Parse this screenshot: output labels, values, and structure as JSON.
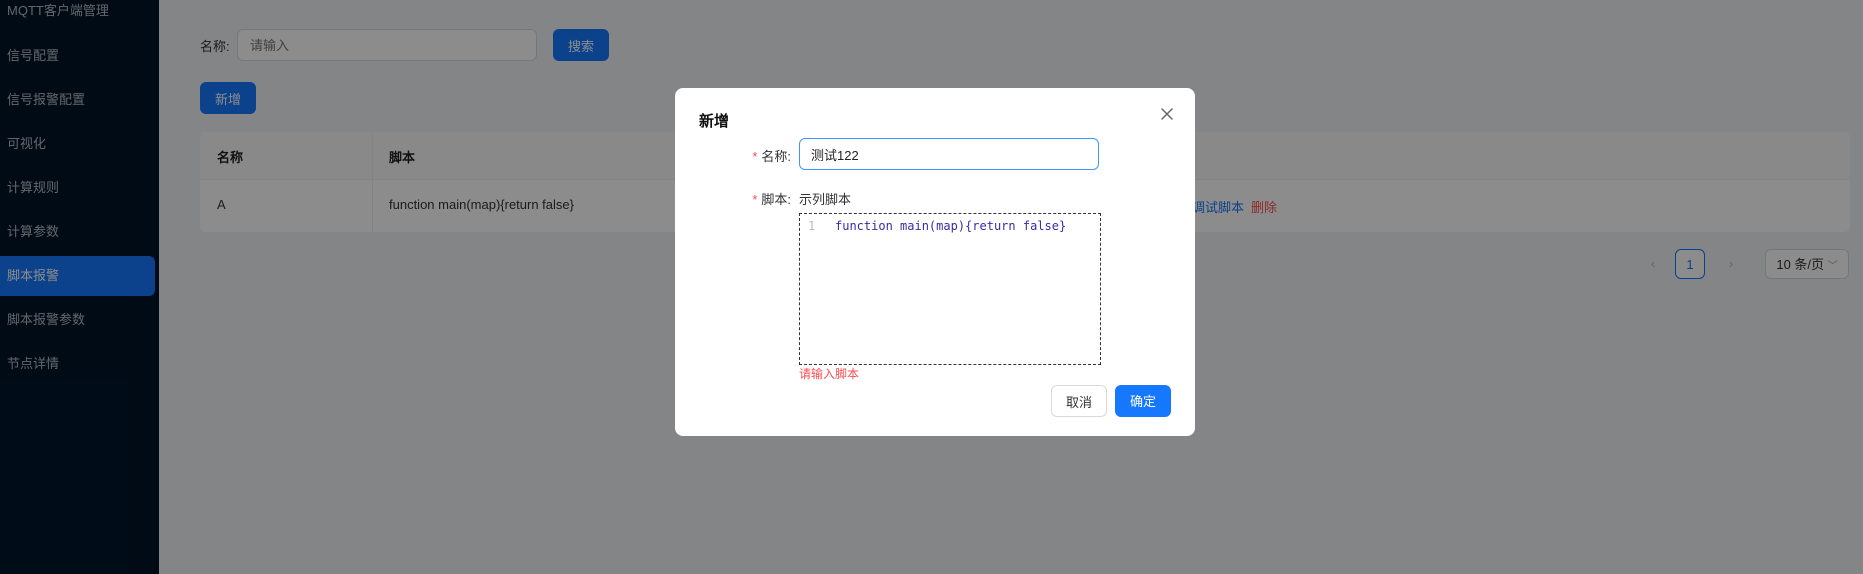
{
  "sidebar": {
    "title": "MQTT客户端管理",
    "items": [
      {
        "label": "信号配置"
      },
      {
        "label": "信号报警配置"
      },
      {
        "label": "可视化"
      },
      {
        "label": "计算规则"
      },
      {
        "label": "计算参数"
      },
      {
        "label": "脚本报警",
        "active": true
      },
      {
        "label": "脚本报警参数"
      },
      {
        "label": "节点详情"
      }
    ]
  },
  "search": {
    "label": "名称:",
    "placeholder": "请输入",
    "button": "搜索"
  },
  "add_button": "新增",
  "table": {
    "columns": [
      "名称",
      "脚本"
    ],
    "rows": [
      {
        "name": "A",
        "script": "function main(map){return false}",
        "actions": [
          "调试脚本",
          "删除"
        ]
      }
    ]
  },
  "pagination": {
    "current": "1",
    "page_size": "10 条/页"
  },
  "modal": {
    "title": "新增",
    "name_label": "名称:",
    "name_value": "测试122",
    "script_label": "脚本:",
    "sample_link": "示列脚本",
    "editor": {
      "line_number": "1",
      "code": "function main(map){return false}"
    },
    "error": "请输入脚本",
    "cancel": "取消",
    "ok": "确定"
  },
  "colors": {
    "primary": "#1677ff",
    "sidebar": "#001529",
    "danger": "#ff4d4f"
  }
}
